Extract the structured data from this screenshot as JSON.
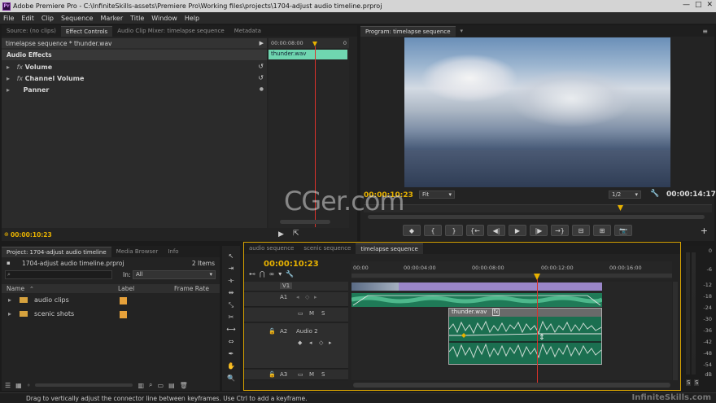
{
  "window": {
    "app_title": "Adobe Premiere Pro - C:\\InfiniteSkills-assets\\Premiere Pro\\Working files\\projects\\1704-adjust audio timeline.prproj",
    "logo_text": "Pr",
    "controls": [
      "—",
      "□",
      "✕"
    ]
  },
  "menu": [
    "File",
    "Edit",
    "Clip",
    "Sequence",
    "Marker",
    "Title",
    "Window",
    "Help"
  ],
  "source_panel": {
    "tabs": [
      "Source: (no clips)",
      "Effect Controls",
      "Audio Clip Mixer: timelapse sequence",
      "Metadata"
    ],
    "active_tab": 1,
    "effect_header": "timelapse sequence * thunder.wav",
    "ruler_time": "00:00:08:00",
    "ruler_end": "0",
    "clip_name": "thunder.wav",
    "section": "Audio Effects",
    "effects": [
      {
        "name": "Volume",
        "fx": "fx"
      },
      {
        "name": "Channel Volume",
        "fx": "fx"
      },
      {
        "name": "Panner",
        "fx": ""
      }
    ],
    "timecode": "00:00:10:23"
  },
  "program_panel": {
    "tab": "Program: timelapse sequence",
    "timecode_left": "00:00:10:23",
    "fit": "Fit",
    "resolution": "1/2",
    "timecode_right": "00:00:14:17",
    "transport": [
      "◆",
      "{",
      "}",
      "{←",
      "◀|",
      "▶",
      "|▶",
      "→}",
      "⊟",
      "⊞",
      "📷"
    ],
    "add": "+"
  },
  "project_panel": {
    "tabs": [
      "Project: 1704-adjust audio timeline",
      "Media Browser",
      "Info"
    ],
    "file": "1704-adjust audio timeline.prproj",
    "items_count": "2 Items",
    "in_label": "In:",
    "in_value": "All",
    "columns": [
      "Name",
      "Label",
      "Frame Rate"
    ],
    "items": [
      {
        "name": "audio clips",
        "color": "#e6a13a"
      },
      {
        "name": "scenic shots",
        "color": "#e6a13a"
      }
    ]
  },
  "timeline": {
    "tabs": [
      "audio sequence",
      "scenic sequence",
      "timelapse sequence"
    ],
    "active_tab": 2,
    "timecode": "00:00:10:23",
    "ruler": [
      "00:00",
      "00:00:04:00",
      "00:00:08:00",
      "00:00:12:00",
      "00:00:16:00"
    ],
    "tracks": {
      "v1": "V1",
      "a1": "A1",
      "a2": "A2",
      "a2_name": "Audio 2",
      "a3": "A3",
      "m": "M",
      "s": "S"
    },
    "clip_name": "thunder.wav",
    "clip_fx": "fx"
  },
  "meters": {
    "labels": [
      "0",
      "-6",
      "-12",
      "-18",
      "-24",
      "-30",
      "-36",
      "-42",
      "-48",
      "-54",
      "dB"
    ],
    "solo": [
      "S",
      "S"
    ]
  },
  "status": "Drag to vertically adjust the connector line between keyframes. Use Ctrl to add a keyframe.",
  "watermark": "CGer.com",
  "brand": "InfiniteSkills.com",
  "colors": {
    "accent": "#e8b200",
    "playhead": "#d9322b",
    "audio_clip": "#1f7a57",
    "video_clip": "#9a86c8",
    "selected_audio": "#6fd6b0"
  }
}
